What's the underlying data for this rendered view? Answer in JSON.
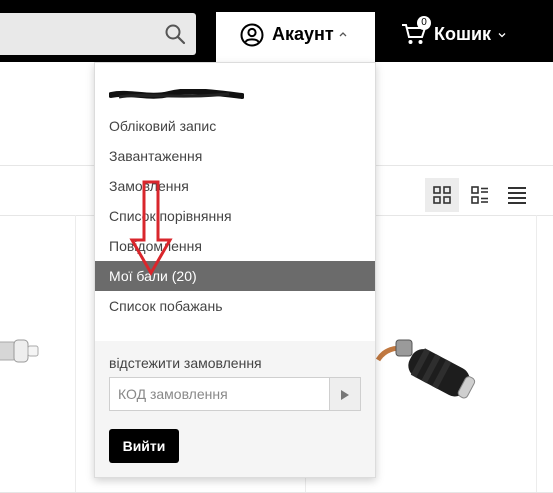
{
  "header": {
    "account_label": "Акаунт",
    "cart_label": "Кошик",
    "cart_count": "0"
  },
  "account_menu": {
    "username": "",
    "items": [
      {
        "label": "Обліковий запис",
        "active": false
      },
      {
        "label": "Завантаження",
        "active": false
      },
      {
        "label": "Замовлення",
        "active": false
      },
      {
        "label": "Список порівняння",
        "active": false
      },
      {
        "label": "Повідомлення",
        "active": false
      },
      {
        "label": "Мої бали (20)",
        "active": true
      },
      {
        "label": "Список побажань",
        "active": false
      }
    ],
    "track_order": {
      "title": "відстежити замовлення",
      "placeholder": "КОД замовлення"
    },
    "logout_label": "Вийти"
  },
  "colors": {
    "header_bg": "#000000",
    "active_item_bg": "#6b6b6b",
    "annotation_arrow": "#d9262c"
  },
  "icons": {
    "search": "search-icon",
    "account": "user-circle-icon",
    "cart": "cart-icon",
    "grid_view": "grid-view-icon",
    "list_view": "list-view-icon",
    "compact_view": "compact-list-icon"
  }
}
